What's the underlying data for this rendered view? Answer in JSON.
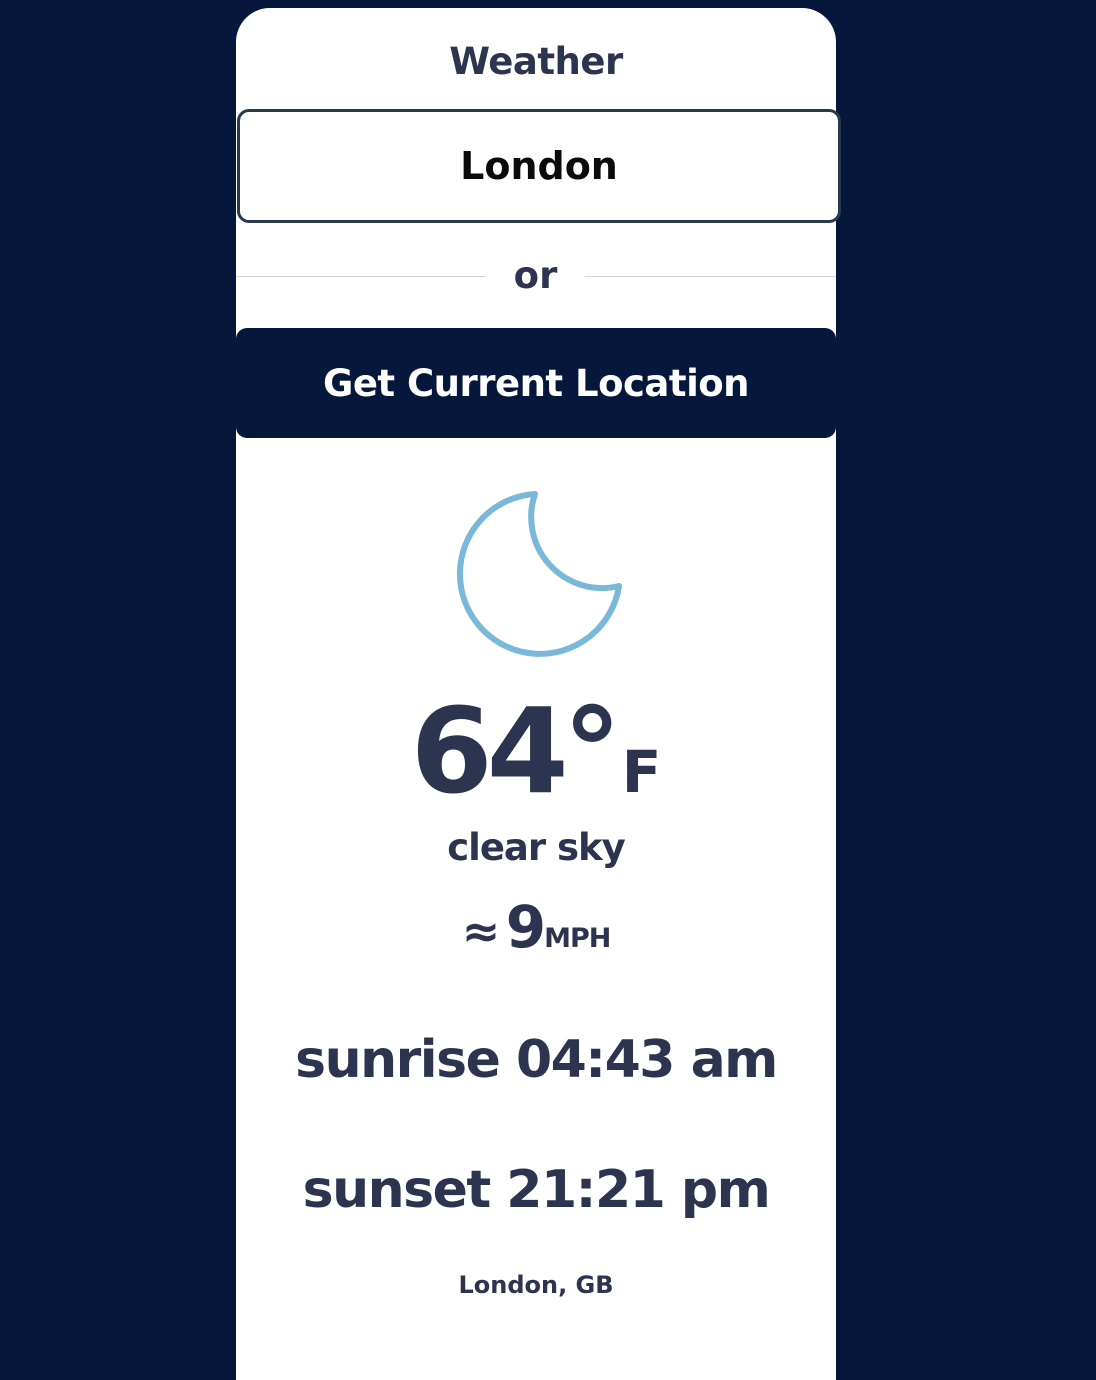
{
  "header": {
    "title": "Weather"
  },
  "search": {
    "value": "London"
  },
  "divider": {
    "text": "or"
  },
  "location_button": {
    "label": "Get Current Location"
  },
  "weather": {
    "icon": "moon-icon",
    "icon_color": "#7ab8d9",
    "temperature": "64°",
    "unit": "F",
    "description": "clear sky",
    "wind_icon": "≈",
    "wind_speed": "9",
    "wind_unit": "MPH",
    "sunrise": "sunrise 04:43 am",
    "sunset": "sunset 21:21 pm",
    "location": "London, GB"
  },
  "colors": {
    "background": "#05183c",
    "card": "#ffffff",
    "text": "#2c3450"
  }
}
